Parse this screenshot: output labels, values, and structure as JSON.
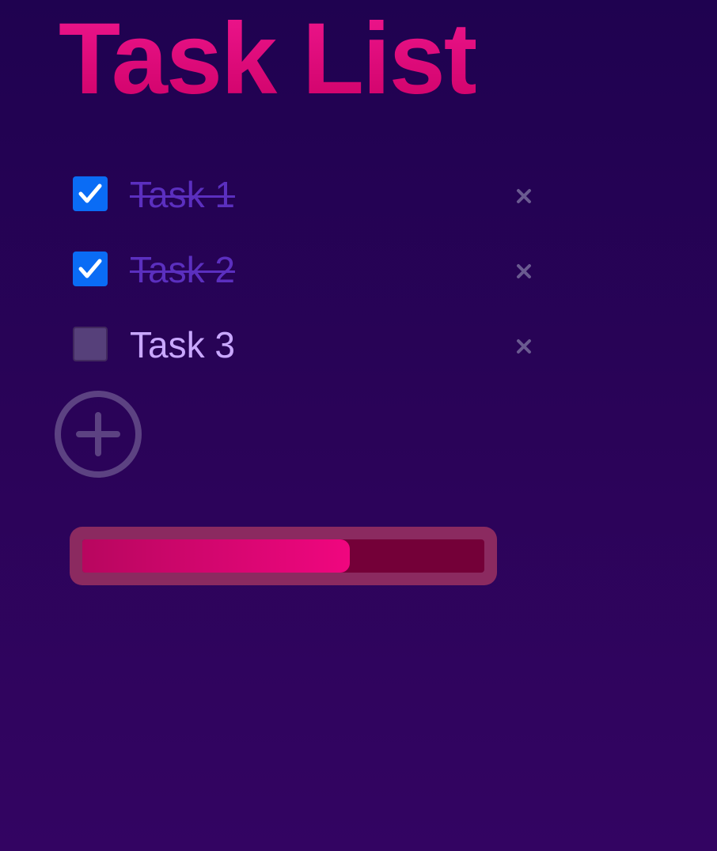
{
  "app": {
    "title": "Task List"
  },
  "tasks": [
    {
      "label": "Task 1",
      "completed": true
    },
    {
      "label": "Task 2",
      "completed": true
    },
    {
      "label": "Task 3",
      "completed": false
    }
  ],
  "icons": {
    "checkmark": "checkmark-icon",
    "delete": "close-icon",
    "add": "plus-circle-icon"
  },
  "progress": {
    "fraction": 0.666
  },
  "colors": {
    "title": "#e0107f",
    "checkbox_checked": "#0a6cf5",
    "done_text": "#5b2fbf",
    "open_text": "#c9a8ff",
    "progress_fill": "#f0067f",
    "progress_track": "#740038"
  }
}
